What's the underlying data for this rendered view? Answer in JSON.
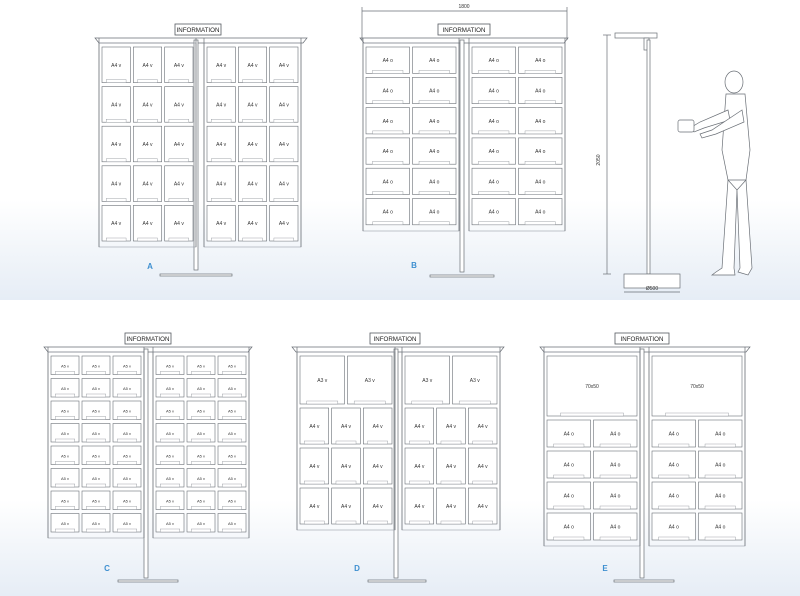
{
  "header_text": "INFORMATION",
  "dimensions": {
    "width_label": "1800",
    "height_label": "2050",
    "base_label": "Ø500"
  },
  "stands": [
    {
      "letter": "A",
      "panels": [
        {
          "rows": [
            [
              "A4 v",
              "A4 v",
              "A4 v"
            ],
            [
              "A4 v",
              "A4 v",
              "A4 v"
            ],
            [
              "A4 v",
              "A4 v",
              "A4 v"
            ],
            [
              "A4 v",
              "A4 v",
              "A4 v"
            ],
            [
              "A4 v",
              "A4 v",
              "A4 v"
            ]
          ]
        },
        {
          "rows": [
            [
              "A4 v",
              "A4 v",
              "A4 v"
            ],
            [
              "A4 v",
              "A4 v",
              "A4 v"
            ],
            [
              "A4 v",
              "A4 v",
              "A4 v"
            ],
            [
              "A4 v",
              "A4 v",
              "A4 v"
            ],
            [
              "A4 v",
              "A4 v",
              "A4 v"
            ]
          ]
        }
      ]
    },
    {
      "letter": "B",
      "panels": [
        {
          "rows": [
            [
              "A4 o",
              "A4 o"
            ],
            [
              "A4 o",
              "A4 o"
            ],
            [
              "A4 o",
              "A4 o"
            ],
            [
              "A4 o",
              "A4 o"
            ],
            [
              "A4 o",
              "A4 o"
            ],
            [
              "A4 o",
              "A4 o"
            ]
          ]
        },
        {
          "rows": [
            [
              "A4 o",
              "A4 o"
            ],
            [
              "A4 o",
              "A4 o"
            ],
            [
              "A4 o",
              "A4 o"
            ],
            [
              "A4 o",
              "A4 o"
            ],
            [
              "A4 o",
              "A4 o"
            ],
            [
              "A4 o",
              "A4 o"
            ]
          ]
        }
      ]
    },
    {
      "letter": "C",
      "panels": [
        {
          "rows": [
            [
              "A5 v",
              "A5 v",
              "A5 v"
            ],
            [
              "A5 v",
              "A5 v",
              "A5 v"
            ],
            [
              "A5 v",
              "A5 v",
              "A5 v"
            ],
            [
              "A5 v",
              "A5 v",
              "A5 v"
            ],
            [
              "A5 v",
              "A5 v",
              "A5 v"
            ],
            [
              "A5 v",
              "A5 v",
              "A5 v"
            ],
            [
              "A5 v",
              "A5 v",
              "A5 v"
            ],
            [
              "A5 v",
              "A5 v",
              "A5 v"
            ]
          ]
        },
        {
          "rows": [
            [
              "A5 v",
              "A5 v",
              "A5 v"
            ],
            [
              "A5 v",
              "A5 v",
              "A5 v"
            ],
            [
              "A5 v",
              "A5 v",
              "A5 v"
            ],
            [
              "A5 v",
              "A5 v",
              "A5 v"
            ],
            [
              "A5 v",
              "A5 v",
              "A5 v"
            ],
            [
              "A5 v",
              "A5 v",
              "A5 v"
            ],
            [
              "A5 v",
              "A5 v",
              "A5 v"
            ],
            [
              "A5 v",
              "A5 v",
              "A5 v"
            ]
          ]
        }
      ]
    },
    {
      "letter": "D",
      "panels": [
        {
          "rows": [
            [
              "A3 v",
              "A3 v"
            ],
            [
              "A4 v",
              "A4 v",
              "A4 v"
            ],
            [
              "A4 v",
              "A4 v",
              "A4 v"
            ],
            [
              "A4 v",
              "A4 v",
              "A4 v"
            ]
          ]
        },
        {
          "rows": [
            [
              "A3 v",
              "A3 v"
            ],
            [
              "A4 v",
              "A4 v",
              "A4 v"
            ],
            [
              "A4 v",
              "A4 v",
              "A4 v"
            ],
            [
              "A4 v",
              "A4 v",
              "A4 v"
            ]
          ]
        }
      ]
    },
    {
      "letter": "E",
      "panels": [
        {
          "rows": [
            [
              "70x50"
            ],
            [
              "A4 o",
              "A4 o"
            ],
            [
              "A4 o",
              "A4 o"
            ],
            [
              "A4 o",
              "A4 o"
            ],
            [
              "A4 o",
              "A4 o"
            ]
          ]
        },
        {
          "rows": [
            [
              "70x50"
            ],
            [
              "A4 o",
              "A4 o"
            ],
            [
              "A4 o",
              "A4 o"
            ],
            [
              "A4 o",
              "A4 o"
            ],
            [
              "A4 o",
              "A4 o"
            ]
          ]
        }
      ]
    }
  ]
}
